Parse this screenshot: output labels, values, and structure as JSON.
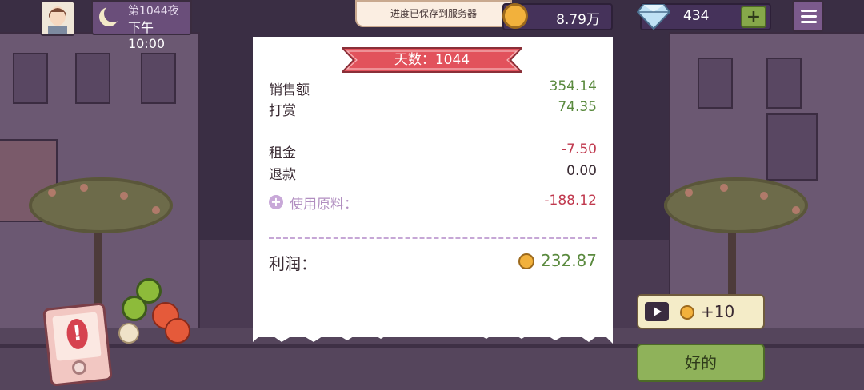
{
  "hud": {
    "night_label": "第1044夜",
    "time": "下午10:00",
    "save_toast": "进度已保存到服务器",
    "coins": "8.79万",
    "gems": "434",
    "gem_plus": "+"
  },
  "receipt": {
    "day_title": "天数：1044",
    "sales_label": "销售额",
    "sales_value": "354.14",
    "tips_label": "打赏",
    "tips_value": "74.35",
    "rent_label": "租金",
    "rent_value": "-7.50",
    "refund_label": "退款",
    "refund_value": "0.00",
    "materials_label": "使用原料：",
    "materials_value": "-188.12",
    "profit_label": "利润：",
    "profit_value": "232.87"
  },
  "actions": {
    "ad_reward_label": "+10",
    "ok_label": "好的"
  },
  "colors": {
    "positive": "#5a8a3e",
    "negative": "#c0394e",
    "ribbon": "#e2525c",
    "ok_button": "#8fb25a"
  }
}
